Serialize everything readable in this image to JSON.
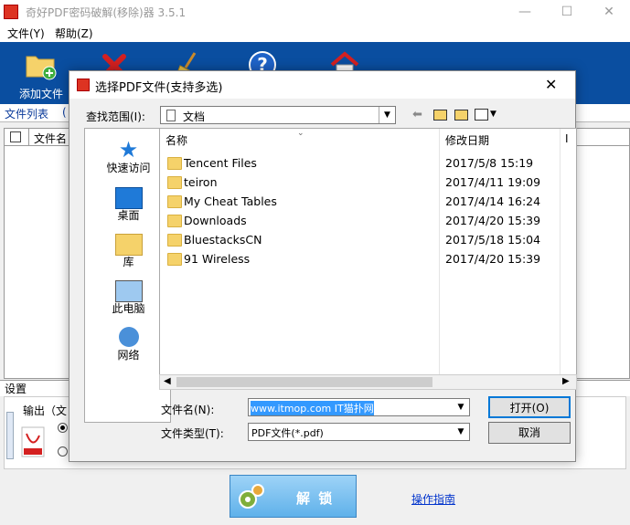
{
  "app": {
    "title": "奇好PDF密码破解(移除)器 3.5.1",
    "window_controls": {
      "minimize": "—",
      "maximize": "☐",
      "close": "✕"
    }
  },
  "menu": [
    "文件(Y)",
    "帮助(Z)"
  ],
  "toolbar": {
    "add_file": "添加文件"
  },
  "file_list": {
    "tab": "文件列表",
    "tab_extra": "(",
    "col_name": "文件名"
  },
  "settings": {
    "title": "设置",
    "output_label": "输出（文"
  },
  "bottom": {
    "unlock": "解 锁",
    "guide": "操作指南"
  },
  "dialog": {
    "title": "选择PDF文件(支持多选)",
    "close": "✕",
    "lookin_label": "查找范围(I):",
    "lookin_value": "文档",
    "places": [
      "快速访问",
      "桌面",
      "库",
      "此电脑",
      "网络"
    ],
    "columns": {
      "name": "名称",
      "date": "修改日期",
      "extra": "I"
    },
    "files": [
      {
        "name": "Tencent Files",
        "date": "2017/5/8 15:19"
      },
      {
        "name": "teiron",
        "date": "2017/4/11 19:09"
      },
      {
        "name": "My Cheat Tables",
        "date": "2017/4/14 16:24"
      },
      {
        "name": "Downloads",
        "date": "2017/4/20 15:39"
      },
      {
        "name": "BluestacksCN",
        "date": "2017/5/18 15:04"
      },
      {
        "name": "91 Wireless",
        "date": "2017/4/20 15:39"
      }
    ],
    "filename_label": "文件名(N):",
    "filename_value": "www.itmop.com IT猫扑网",
    "filetype_label": "文件类型(T):",
    "filetype_value": "PDF文件(*.pdf)",
    "open_button": "打开(O)",
    "cancel_button": "取消"
  },
  "colors": {
    "toolbar_bg": "#0a4ea0",
    "selection": "#3399ff",
    "folder": "#f5d26a"
  }
}
